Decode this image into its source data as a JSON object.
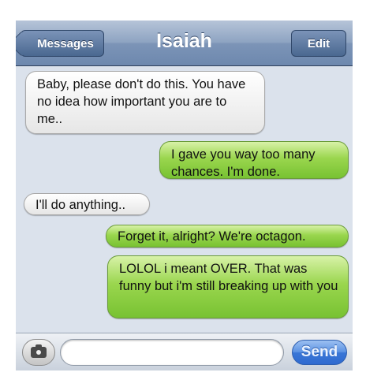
{
  "navbar": {
    "back_label": "Messages",
    "title": "Isaiah",
    "edit_label": "Edit"
  },
  "messages": [
    {
      "direction": "received",
      "text": "Baby, please don't do this. You have no idea how important you are to me.."
    },
    {
      "direction": "sent",
      "text": "I gave you way too many chances. I'm done."
    },
    {
      "direction": "received",
      "text": "I'll do anything.."
    },
    {
      "direction": "sent",
      "text": "Forget it, alright? We're octagon."
    },
    {
      "direction": "sent",
      "text": "LOLOL i meant OVER. That was funny but i'm still breaking up with you"
    }
  ],
  "inputbar": {
    "camera_icon": "camera-icon",
    "input_value": "",
    "send_label": "Send"
  },
  "colors": {
    "background": "#dbe2ec",
    "sent_bubble": "#9ad64e",
    "received_bubble": "#ffffff",
    "navbar": "#8ea4c2",
    "send_button": "#3a77d6"
  }
}
